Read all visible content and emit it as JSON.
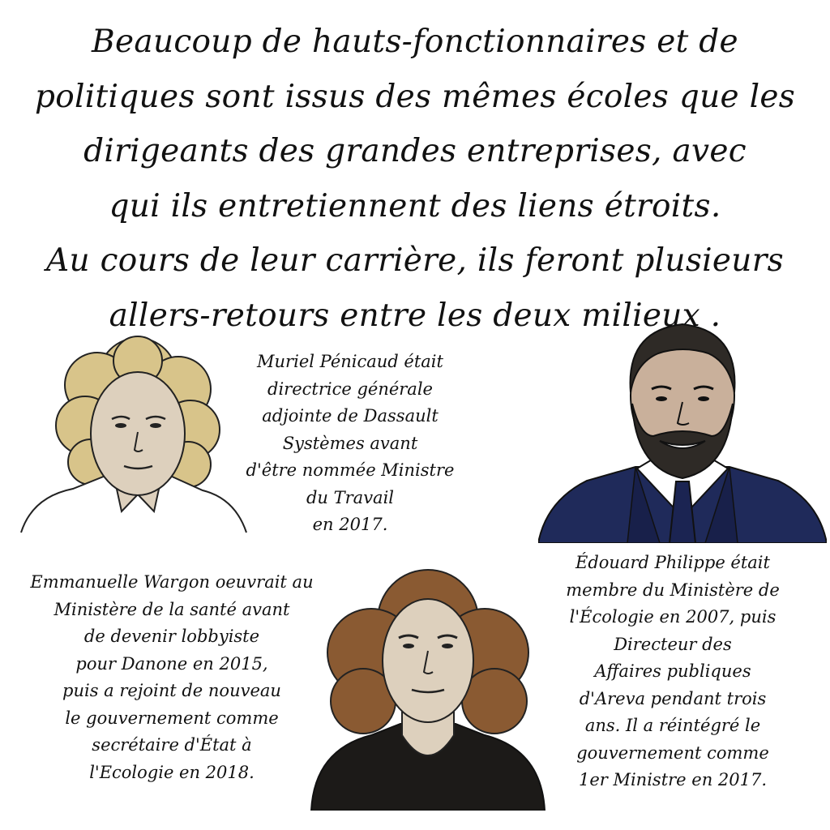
{
  "headline": {
    "lines": [
      "Beaucoup de hauts-fonctionnaires et de",
      "politiques sont issus des mêmes écoles que les",
      "dirigeants des grandes entreprises, avec",
      "qui ils entretiennent des liens étroits.",
      "Au cours de leur carrière, ils feront plusieurs",
      "allers-retours entre les deux milieux ."
    ]
  },
  "penicaud": {
    "lines": [
      "Muriel Pénicaud était",
      "directrice générale",
      "adjointe de Dassault",
      "Systèmes avant",
      "d'être nommée Ministre",
      "du Travail",
      "en 2017."
    ]
  },
  "philippe": {
    "lines": [
      "Édouard Philippe était",
      "membre du Ministère de",
      "l'Écologie en 2007, puis",
      "Directeur des",
      "Affaires publiques",
      "d'Areva pendant trois",
      "ans. Il a réintégré le",
      "gouvernement comme",
      "1er Ministre en 2017."
    ]
  },
  "wargon": {
    "lines": [
      "Emmanuelle Wargon oeuvrait au",
      "Ministère de la santé avant",
      "de devenir lobbyiste",
      "pour Danone en 2015,",
      "puis a rejoint de nouveau",
      "le gouvernement comme",
      "secrétaire d'État à",
      "l'Ecologie en 2018."
    ]
  },
  "colors": {
    "curly_blonde_hair": "#d8c48a",
    "skin_light": "#ddd0bd",
    "skin_tan": "#c9b09b",
    "beard_dark": "#2e2a26",
    "suit_navy": "#1f2a5a",
    "brown_hair": "#8a5a32",
    "black_top": "#1c1a18"
  }
}
